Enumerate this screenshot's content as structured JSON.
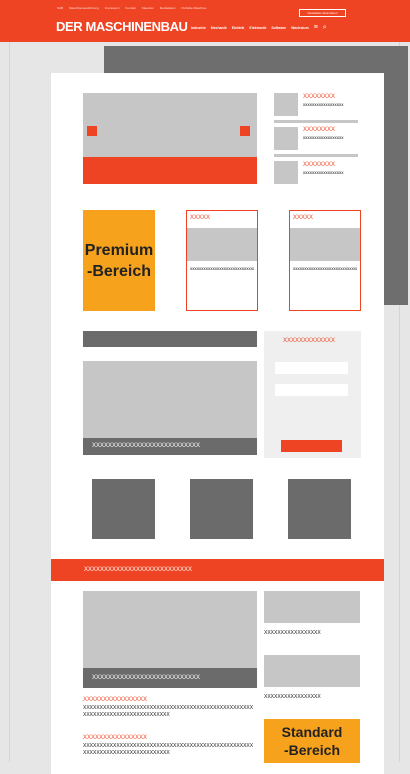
{
  "header": {
    "topnav": [
      "SUB",
      "Maschinenausführung",
      "Impressum",
      "Kontakt",
      "Kalender",
      "Mediadaten",
      "Perfekte Maschine"
    ],
    "newsletter_label": "Newsletter abonnieren",
    "logo": "DER MASCHINENBAU",
    "mainnav": [
      "Industrie",
      "Mechanik",
      "Elektrik",
      "Elektronik",
      "Software",
      "Wachstum"
    ],
    "menu_icon": "≡",
    "search_icon": "⌕"
  },
  "top_section": {
    "side_teasers": [
      {
        "title": "XXXXXXXX",
        "text": "xxxxxxxxxxxxxxxxxx"
      },
      {
        "title": "XXXXXXXX",
        "text": "xxxxxxxxxxxxxxxxxx"
      },
      {
        "title": "XXXXXXXX",
        "text": "xxxxxxxxxxxxxxxxxx"
      }
    ]
  },
  "premium": {
    "line1": "Premium",
    "line2": "-Bereich",
    "boxes": [
      {
        "title": "XXXXX",
        "text": "xxxxxxxxxxxxxxxxxxxxxxxxxxxxxxxxxxxxx"
      },
      {
        "title": "XXXXX",
        "text": "xxxxxxxxxxxxxxxxxxxxxxxxxxxxxxxxxxxxx"
      }
    ]
  },
  "feature": {
    "caption": "XXXXXXXXXXXXXXXXXXXXXXXXXXX",
    "sidebar_title": "XXXXXXXXXXXXX"
  },
  "orange_bar": {
    "text": "XXXXXXXXXXXXXXXXXXXXXXXXXXX"
  },
  "bottom_section": {
    "caption": "XXXXXXXXXXXXXXXXXXXXXXXXXXX",
    "right_captions": [
      "XXXXXXXXXXXXXXXXX",
      "XXXXXXXXXXXXXXXXX"
    ],
    "articles": [
      {
        "title": "XXXXXXXXXXXXXXXX",
        "text": "XXXXXXXXXXXXXXXXXXXXXXXXXXXXXXXXXXXXXXXXXXXXXXXXXXXXXXXXXXXXXXXXXXXXXXXXXXXXX"
      },
      {
        "title": "XXXXXXXXXXXXXXXX",
        "text": "XXXXXXXXXXXXXXXXXXXXXXXXXXXXXXXXXXXXXXXXXXXXXXXXXXXXXXXXXXXXXXXXXXXXXXXXXXXXX"
      }
    ],
    "standard_line1": "Standard",
    "standard_line2": "-Bereich"
  }
}
